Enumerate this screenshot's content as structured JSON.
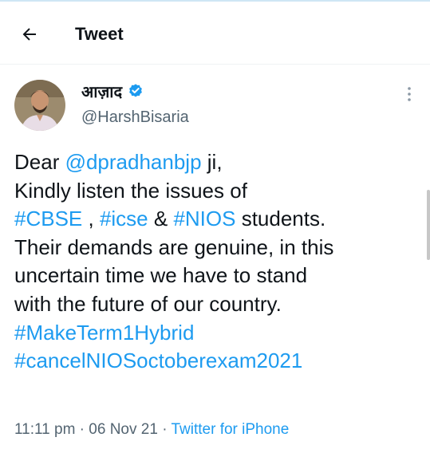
{
  "header": {
    "title": "Tweet",
    "back_icon": "arrow-left-icon"
  },
  "author": {
    "name": "आज़ाद",
    "handle": "@HarshBisaria",
    "verified_icon": "verified-badge-icon",
    "more_icon": "more-vertical-icon"
  },
  "tweet": {
    "l1": {
      "a": "Dear ",
      "b": "@dpradhanbjp",
      "c": " ji,"
    },
    "l2": {
      "a": "Kindly listen the issues of"
    },
    "l3": {
      "a": "#CBSE",
      "b": " , ",
      "c": "#icse",
      "d": " & ",
      "e": "#NIOS",
      "f": " students."
    },
    "l4": {
      "a": "Their demands are genuine, in this"
    },
    "l5": {
      "a": "uncertain time we have to stand"
    },
    "l6": {
      "a": "with the future of our country."
    },
    "l7": {
      "a": "#MakeTerm1Hybrid"
    },
    "l8": {
      "a": "#cancelNIOSoctoberexam2021"
    }
  },
  "meta": {
    "time": "11:11 pm",
    "sep1": " · ",
    "date": "06 Nov 21",
    "sep2": " · ",
    "source": "Twitter for iPhone"
  },
  "colors": {
    "link": "#1d9bf0",
    "text": "#0f1419",
    "muted": "#536471"
  }
}
